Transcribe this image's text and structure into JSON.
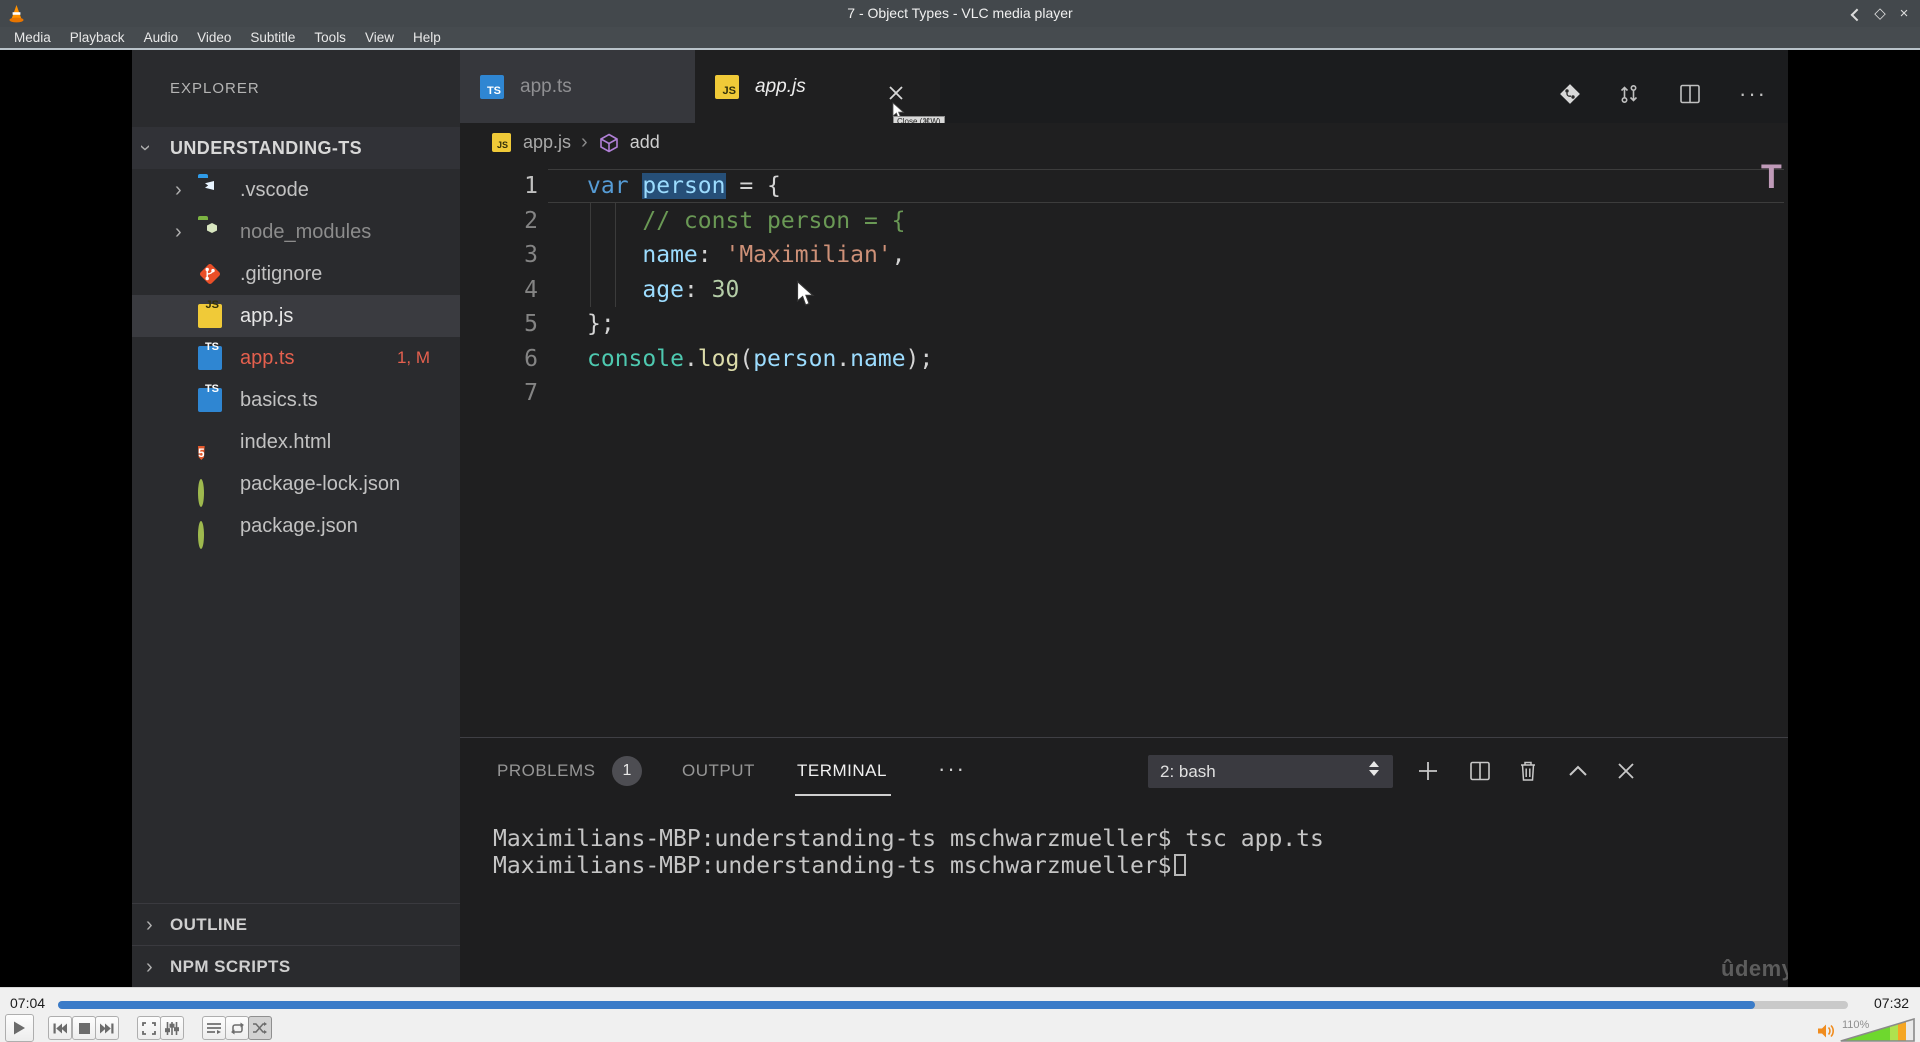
{
  "colors": {
    "vlc_chrome": "#43484c",
    "vlc_seek_blue": "#3a7bc8",
    "editor_bg": "#1f1f20",
    "sidebar_bg": "#2a2b2e",
    "error_red": "#e5604e",
    "ts_blue": "#2f86d2",
    "js_yellow": "#f0ca38",
    "html_orange": "#e4592c",
    "git_orange": "#ea4f28",
    "comment_green": "#6a9955",
    "string_orange": "#ce9178",
    "keyword_blue": "#569cd6",
    "selection_blue": "#264f78",
    "volume_green": "#6ed82e",
    "volume_orange": "#f5a623"
  },
  "vlc": {
    "window_title": "7 - Object Types - VLC media player",
    "menu_items": [
      "Media",
      "Playback",
      "Audio",
      "Video",
      "Subtitle",
      "Tools",
      "View",
      "Help"
    ],
    "current_time": "07:04",
    "total_time": "07:32",
    "volume_percent": "110%",
    "seek_fraction": 0.948
  },
  "vscode": {
    "explorer": {
      "title": "EXPLORER",
      "project": "UNDERSTANDING-TS",
      "files": [
        {
          "name": ".vscode",
          "icon": "vscode-folder-icon"
        },
        {
          "name": "node_modules",
          "icon": "node-modules-folder-icon"
        },
        {
          "name": ".gitignore",
          "icon": "git-file-icon"
        },
        {
          "name": "app.js",
          "icon": "javascript-file-icon"
        },
        {
          "name": "app.ts",
          "icon": "typescript-file-icon",
          "badge": "1, M"
        },
        {
          "name": "basics.ts",
          "icon": "typescript-file-icon"
        },
        {
          "name": "index.html",
          "icon": "html-file-icon"
        },
        {
          "name": "package-lock.json",
          "icon": "json-file-icon"
        },
        {
          "name": "package.json",
          "icon": "json-file-icon"
        }
      ],
      "sections": [
        "OUTLINE",
        "NPM SCRIPTS"
      ]
    },
    "tabs": [
      {
        "label": "app.ts"
      },
      {
        "label": "app.js"
      }
    ],
    "close_tooltip": "Close (⌘W)",
    "breadcrumb": {
      "file": "app.js",
      "symbol": "add"
    },
    "editor": {
      "line_numbers": [
        "1",
        "2",
        "3",
        "4",
        "5",
        "6",
        "7"
      ],
      "lines": [
        {
          "tokens": [
            {
              "t": "var"
            },
            {
              "t": " "
            },
            {
              "t": "person"
            },
            {
              "t": " = {"
            }
          ]
        },
        {
          "tokens": [
            {
              "t": "    // const person = {"
            }
          ]
        },
        {
          "tokens": [
            {
              "t": "    name"
            },
            {
              "t": ": "
            },
            {
              "t": "'Maximilian'"
            },
            {
              "t": ","
            }
          ]
        },
        {
          "tokens": [
            {
              "t": "    age"
            },
            {
              "t": ": "
            },
            {
              "t": "30"
            }
          ]
        },
        {
          "tokens": [
            {
              "t": "};"
            }
          ]
        },
        {
          "tokens": [
            {
              "t": "console"
            },
            {
              "t": "."
            },
            {
              "t": "log"
            },
            {
              "t": "("
            },
            {
              "t": "person"
            },
            {
              "t": "."
            },
            {
              "t": "name"
            },
            {
              "t": ");"
            }
          ]
        }
      ],
      "overlay_letter": "T"
    },
    "panel": {
      "tabs": [
        {
          "label": "PROBLEMS",
          "badge": "1"
        },
        {
          "label": "OUTPUT"
        },
        {
          "label": "TERMINAL"
        }
      ],
      "shell_select": "2: bash",
      "terminal": [
        "Maximilians-MBP:understanding-ts mschwarzmueller$ tsc app.ts",
        "Maximilians-MBP:understanding-ts mschwarzmueller$"
      ]
    },
    "watermark": "ûdemy"
  }
}
